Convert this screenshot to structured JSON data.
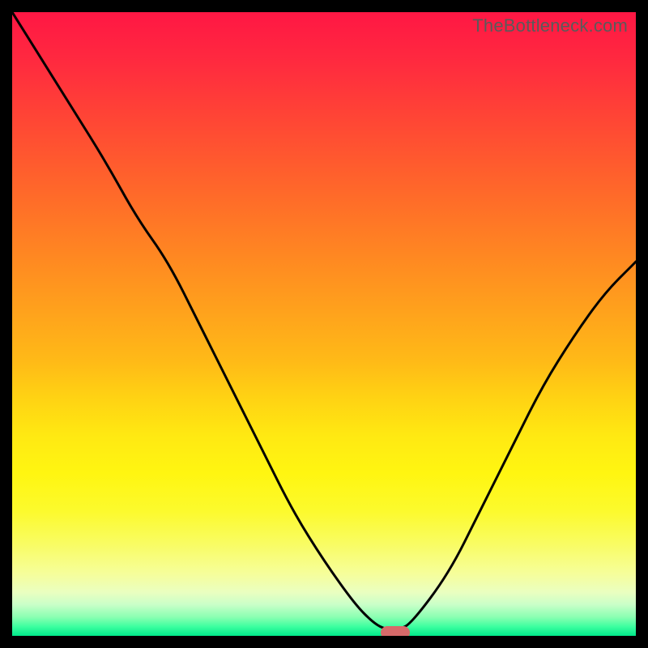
{
  "watermark": "TheBottleneck.com",
  "chart_data": {
    "type": "line",
    "title": "",
    "xlabel": "",
    "ylabel": "",
    "xlim": [
      0,
      100
    ],
    "ylim": [
      0,
      100
    ],
    "grid": false,
    "legend": false,
    "series": [
      {
        "name": "bottleneck-curve",
        "x": [
          0,
          5,
          10,
          15,
          20,
          25,
          30,
          35,
          40,
          45,
          50,
          55,
          58,
          60,
          62,
          64,
          70,
          75,
          80,
          85,
          90,
          95,
          100
        ],
        "values": [
          100,
          92,
          84,
          76,
          67,
          60,
          50,
          40,
          30,
          20,
          12,
          5,
          2,
          1,
          1,
          2,
          10,
          20,
          30,
          40,
          48,
          55,
          60
        ]
      }
    ],
    "marker": {
      "x": 61,
      "y": 1,
      "color": "#d66a6a"
    },
    "background_gradient": {
      "top": "#ff1744",
      "mid": "#ffe912",
      "bottom": "#00e98a"
    }
  }
}
